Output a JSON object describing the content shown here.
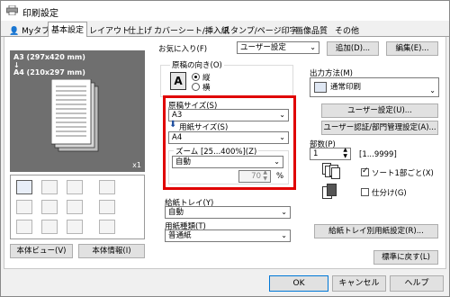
{
  "window": {
    "title": "印刷設定"
  },
  "tabs": [
    {
      "label": "Myタブ"
    },
    {
      "label": "基本設定"
    },
    {
      "label": "レイアウト"
    },
    {
      "label": "仕上げ"
    },
    {
      "label": "カバーシート/挿入紙"
    },
    {
      "label": "スタンプ/ページ印字"
    },
    {
      "label": "画像品質"
    },
    {
      "label": "その他"
    }
  ],
  "preview": {
    "line1": "A3 (297x420 mm)",
    "arrow": "↓",
    "line2": "A4 (210x297 mm)",
    "copies": "x1"
  },
  "left_buttons": {
    "view": "本体ビュー(V)",
    "info": "本体情報(I)"
  },
  "favorite": {
    "label": "お気に入り(F)",
    "value": "ユーザー設定",
    "add": "追加(D)...",
    "edit": "編集(E)..."
  },
  "orientation": {
    "label": "原稿の向き(O)",
    "portrait": "縦",
    "landscape": "横"
  },
  "original_size": {
    "label": "原稿サイズ(S)",
    "value": "A3"
  },
  "paper_size": {
    "label": "用紙サイズ(S)",
    "value": "A4"
  },
  "zoom": {
    "label": "ズーム [25...400%](Z)",
    "value": "自動",
    "percent": "70",
    "unit": "%"
  },
  "paper_tray": {
    "label": "給紙トレイ(Y)",
    "value": "自動"
  },
  "paper_type": {
    "label": "用紙種類(T)",
    "value": "普通紙"
  },
  "output": {
    "label": "出力方法(M)",
    "value": "通常印刷",
    "user_setting": "ユーザー設定(U)...",
    "auth": "ユーザー認証/部門管理設定(A)..."
  },
  "copies": {
    "label": "部数(P)",
    "value": "1",
    "range": "[1...9999]",
    "collate": "ソート1部ごと(X)",
    "offset": "仕分け(G)"
  },
  "tray_paper_btn": "給紙トレイ別用紙設定(R)...",
  "restore": "標準に戻す(L)",
  "footer": {
    "ok": "OK",
    "cancel": "キャンセル",
    "help": "ヘルプ"
  },
  "colors": {
    "highlight": "#e00000",
    "preview_bg": "#6f6f6f",
    "accent": "#0078d7"
  }
}
